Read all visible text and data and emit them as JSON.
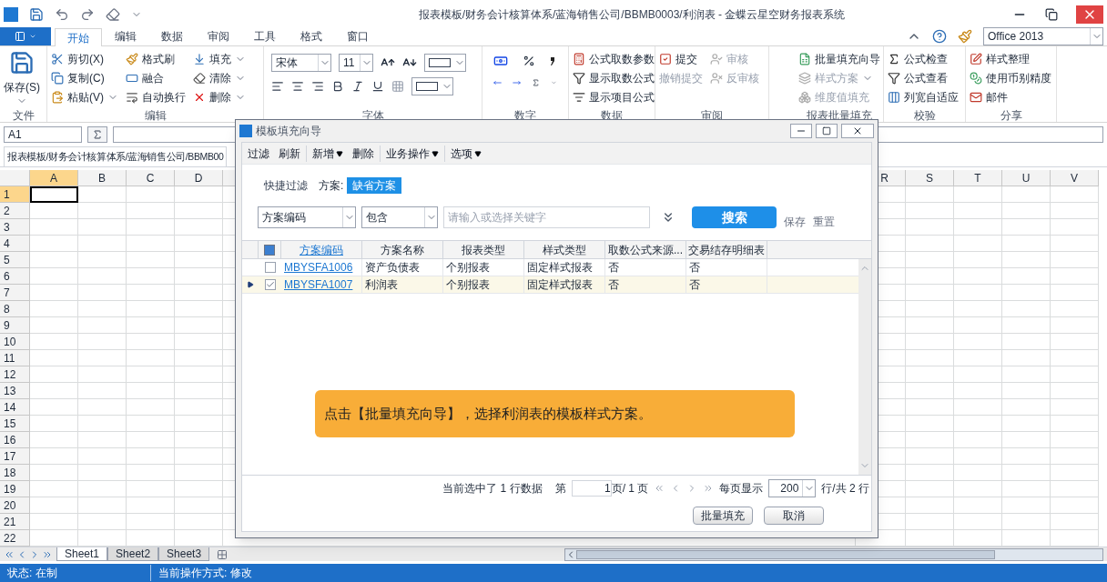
{
  "title_bar": {
    "title": "报表模板/财务会计核算体系/蓝海销售公司/BBMB0003/利润表 - 金蝶云星空财务报表系统"
  },
  "ribbon_tabs": [
    {
      "label": "开始",
      "selected": true
    },
    {
      "label": "编辑",
      "selected": false
    },
    {
      "label": "数据",
      "selected": false
    },
    {
      "label": "审阅",
      "selected": false
    },
    {
      "label": "工具",
      "selected": false
    },
    {
      "label": "格式",
      "selected": false
    },
    {
      "label": "窗口",
      "selected": false
    }
  ],
  "theme_select": {
    "value": "Office 2013"
  },
  "ribbon_groups": [
    {
      "kind": "large",
      "label": "文件",
      "columns": [
        [
          {
            "label": "保存(S)",
            "disabled": false,
            "dropdown": true
          }
        ]
      ]
    },
    {
      "kind": "list",
      "label": "编辑",
      "columns": [
        [
          {
            "label": "剪切(X)",
            "disabled": false,
            "dropdown": false
          },
          {
            "label": "复制(C)",
            "disabled": false,
            "dropdown": false
          },
          {
            "label": "粘贴(V)",
            "disabled": false,
            "dropdown": true
          }
        ],
        [
          {
            "label": "格式刷",
            "disabled": false,
            "dropdown": false
          },
          {
            "label": "融合",
            "disabled": false,
            "dropdown": false
          },
          {
            "label": "自动换行",
            "disabled": false,
            "dropdown": false
          }
        ],
        [
          {
            "label": "填充",
            "disabled": false,
            "dropdown": true
          },
          {
            "label": "清除",
            "disabled": false,
            "dropdown": true
          },
          {
            "label": "删除",
            "disabled": false,
            "dropdown": true
          }
        ]
      ]
    },
    {
      "kind": "font",
      "label": "字体",
      "font": "宋体",
      "size": "11"
    },
    {
      "kind": "number",
      "label": "数字"
    },
    {
      "kind": "list",
      "label": "数据",
      "columns": [
        [
          {
            "label": "公式取数参数",
            "disabled": false,
            "dropdown": false
          },
          {
            "label": "显示取数公式",
            "disabled": false,
            "dropdown": false
          },
          {
            "label": "显示项目公式",
            "disabled": false,
            "dropdown": false
          }
        ]
      ]
    },
    {
      "kind": "list",
      "label": "审阅",
      "columns": [
        [
          {
            "label": "提交",
            "disabled": false,
            "dropdown": false
          },
          {
            "label": "撤销提交",
            "disabled": true,
            "dropdown": false
          }
        ],
        [
          {
            "label": "审核",
            "disabled": true,
            "dropdown": false
          },
          {
            "label": "反审核",
            "disabled": true,
            "dropdown": false
          }
        ]
      ]
    },
    {
      "kind": "list",
      "label": "报表批量填充",
      "columns": [
        [
          {
            "label": "批量填充向导",
            "disabled": false,
            "dropdown": false
          },
          {
            "label": "样式方案",
            "disabled": true,
            "dropdown": true
          },
          {
            "label": "维度值填充",
            "disabled": true,
            "dropdown": false
          }
        ]
      ]
    },
    {
      "kind": "list",
      "label": "校验",
      "columns": [
        [
          {
            "label": "公式检查",
            "disabled": false,
            "dropdown": false
          },
          {
            "label": "公式查看",
            "disabled": false,
            "dropdown": false
          },
          {
            "label": "列宽自适应",
            "disabled": false,
            "dropdown": false
          }
        ]
      ]
    },
    {
      "kind": "list",
      "label": "分享",
      "columns": [
        [
          {
            "label": "样式整理",
            "disabled": false,
            "dropdown": false
          },
          {
            "label": "使用币别精度",
            "disabled": false,
            "dropdown": false
          },
          {
            "label": "邮件",
            "disabled": false,
            "dropdown": false
          }
        ]
      ]
    }
  ],
  "formula_bar": {
    "cell": "A1"
  },
  "doc_tab": {
    "label": "报表模板/财务会计核算体系/蓝海销售公司/BBMB00"
  },
  "sheet": {
    "left_columns": [
      {
        "label": "A",
        "selected": true
      },
      {
        "label": "B",
        "selected": false
      },
      {
        "label": "C",
        "selected": false
      },
      {
        "label": "D",
        "selected": false
      }
    ],
    "right_columns": [
      {
        "label": "R",
        "selected": false
      },
      {
        "label": "S",
        "selected": false
      },
      {
        "label": "T",
        "selected": false
      },
      {
        "label": "U",
        "selected": false
      },
      {
        "label": "V",
        "selected": false
      }
    ],
    "rows": [
      {
        "label": "1",
        "selected": true
      },
      {
        "label": "2",
        "selected": false
      },
      {
        "label": "3",
        "selected": false
      },
      {
        "label": "4",
        "selected": false
      },
      {
        "label": "5",
        "selected": false
      },
      {
        "label": "6",
        "selected": false
      },
      {
        "label": "7",
        "selected": false
      },
      {
        "label": "8",
        "selected": false
      },
      {
        "label": "9",
        "selected": false
      },
      {
        "label": "10",
        "selected": false
      },
      {
        "label": "11",
        "selected": false
      },
      {
        "label": "12",
        "selected": false
      },
      {
        "label": "13",
        "selected": false
      },
      {
        "label": "14",
        "selected": false
      },
      {
        "label": "15",
        "selected": false
      },
      {
        "label": "16",
        "selected": false
      },
      {
        "label": "17",
        "selected": false
      },
      {
        "label": "18",
        "selected": false
      },
      {
        "label": "19",
        "selected": false
      },
      {
        "label": "20",
        "selected": false
      },
      {
        "label": "21",
        "selected": false
      },
      {
        "label": "22",
        "selected": false
      }
    ]
  },
  "sheet_tabs": [
    {
      "label": "Sheet1",
      "selected": true
    },
    {
      "label": "Sheet2",
      "selected": false
    },
    {
      "label": "Sheet3",
      "selected": false
    }
  ],
  "status_bar": [
    "状态: 在制",
    "当前操作方式: 修改"
  ],
  "dialog": {
    "title": "模板填充向导",
    "toolbar": [
      [
        {
          "label": "过滤",
          "dropdown": false
        },
        {
          "label": "刷新",
          "dropdown": false
        }
      ],
      [
        {
          "label": "新增",
          "dropdown": true
        },
        {
          "label": "删除",
          "dropdown": false
        }
      ],
      [
        {
          "label": "业务操作",
          "dropdown": true
        }
      ],
      [
        {
          "label": "选项",
          "dropdown": true
        }
      ]
    ],
    "quick_filter": {
      "label": "快捷过滤",
      "scheme_label": "方案:",
      "scheme": "缺省方案"
    },
    "filter_field": "方案编码",
    "operator": "包含",
    "keyword_placeholder": "请输入或选择关键字",
    "search_button": "搜索",
    "links": [
      "保存",
      "重置"
    ],
    "table": {
      "select_all_partial": true,
      "columns": [
        "方案编码",
        "方案名称",
        "报表类型",
        "样式类型",
        "取数公式来源...",
        "交易结存明细表"
      ],
      "rows": [
        {
          "selected": false,
          "checked": false,
          "cells": [
            "MBYSFA1006",
            "资产负债表",
            "个别报表",
            "固定样式报表",
            "否",
            "否"
          ]
        },
        {
          "selected": true,
          "checked": true,
          "cells": [
            "MBYSFA1007",
            "利润表",
            "个别报表",
            "固定样式报表",
            "否",
            "否"
          ]
        }
      ]
    },
    "pagination": {
      "summary": "当前选中了 1 行数据",
      "page_prefix": "第",
      "page": "1",
      "page_suffix": "页/ 1 页",
      "per_page_label": "每页显示",
      "per_page": "200",
      "total": "行/共 2 行"
    },
    "buttons": [
      "批量填充",
      "取消"
    ]
  },
  "tutorial_callout": {
    "text": "点击【批量填充向导】，选择利润表的模板样式方案。"
  }
}
